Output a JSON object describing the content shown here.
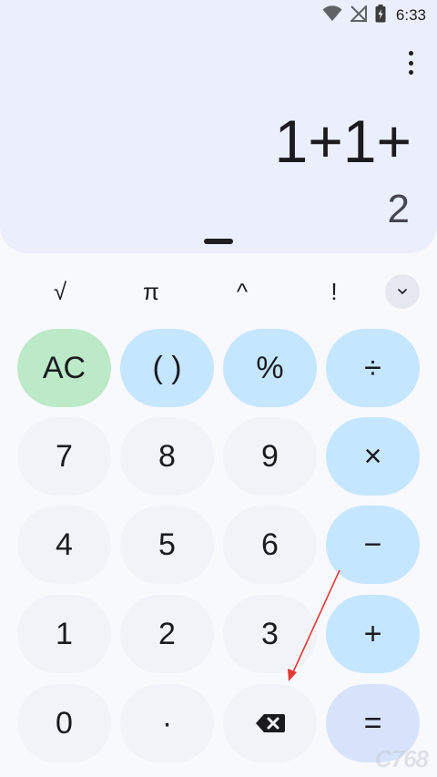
{
  "status_bar": {
    "time": "6:33",
    "icons": [
      "wifi-icon",
      "signal-off-icon",
      "battery-charging-icon"
    ]
  },
  "display": {
    "expression": "1+1+",
    "result": "2"
  },
  "scientific_row": {
    "keys": [
      "√",
      "π",
      "^",
      "!"
    ],
    "expand_icon": "chevron-down-icon"
  },
  "keypad": {
    "ac": "AC",
    "parentheses": "( )",
    "percent": "%",
    "divide": "÷",
    "seven": "7",
    "eight": "8",
    "nine": "9",
    "multiply": "×",
    "four": "4",
    "five": "5",
    "six": "6",
    "minus": "−",
    "one": "1",
    "two": "2",
    "three": "3",
    "plus": "+",
    "zero": "0",
    "decimal": "·",
    "backspace_icon": "backspace-icon",
    "equals": "="
  },
  "colors": {
    "display_bg": "#eaeffb",
    "number_key": "#f1f3f9",
    "operator_key": "#c5e6ff",
    "clear_key": "#bce9c8",
    "equals_key": "#d6e3fb",
    "annotation_arrow": "#e53935"
  },
  "watermark": "C768"
}
